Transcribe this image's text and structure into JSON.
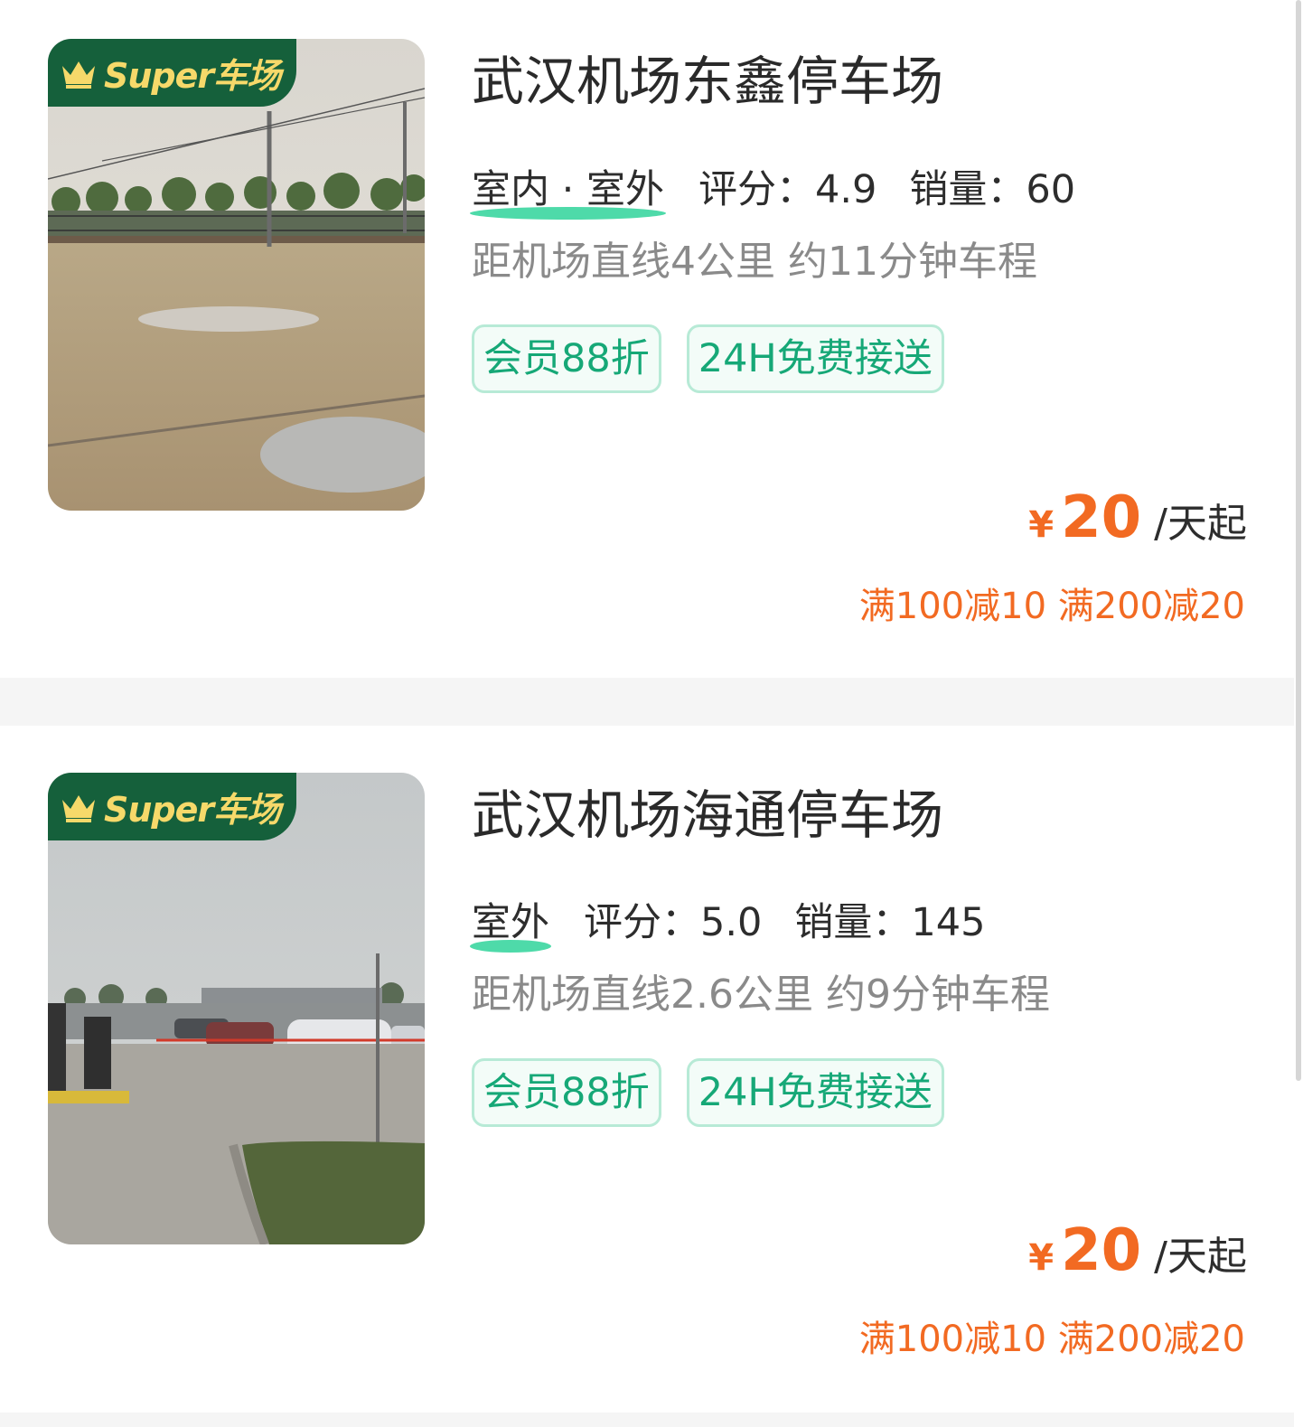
{
  "lots": [
    {
      "badge_text": "Super车场",
      "name": "武汉机场东鑫停车场",
      "type": "室内 · 室外",
      "rating": "评分：4.9",
      "sales": "销量：60",
      "distance": "距机场直线4公里 约11分钟车程",
      "tags": [
        "会员88折",
        "24H免费接送"
      ],
      "currency": "¥",
      "price": "20",
      "price_unit": "/天起",
      "promo": "满100减10 满200减20"
    },
    {
      "badge_text": "Super车场",
      "name": "武汉机场海通停车场",
      "type": "室外",
      "rating": "评分：5.0",
      "sales": "销量：145",
      "distance": "距机场直线2.6公里 约9分钟车程",
      "tags": [
        "会员88折",
        "24H免费接送"
      ],
      "currency": "¥",
      "price": "20",
      "price_unit": "/天起",
      "promo": "满100减10 满200减20"
    }
  ],
  "colors": {
    "brand_green": "#15603b",
    "badge_gold": "#f6d96a",
    "tag_green": "#16a877",
    "price_orange": "#f26a22"
  },
  "icons": {
    "badge": "crown-icon"
  }
}
